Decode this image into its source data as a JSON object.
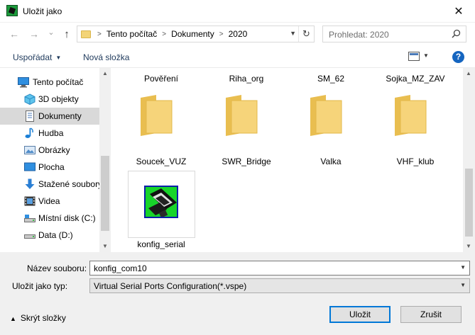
{
  "window": {
    "title": "Uložit jako",
    "close_glyph": "✕"
  },
  "nav": {
    "back_glyph": "←",
    "forward_glyph": "→",
    "recent_glyph": "⌄",
    "up_glyph": "↑",
    "breadcrumbs": [
      "Tento počítač",
      "Dokumenty",
      "2020"
    ],
    "search_placeholder": "Prohledat: 2020"
  },
  "toolbar": {
    "organize": "Uspořádat",
    "new_folder": "Nová složka",
    "help": "?"
  },
  "sidebar": {
    "items": [
      {
        "label": "Tento počítač",
        "icon": "computer-icon"
      },
      {
        "label": "3D objekty",
        "icon": "3d-objects-icon"
      },
      {
        "label": "Dokumenty",
        "icon": "documents-icon",
        "selected": true
      },
      {
        "label": "Hudba",
        "icon": "music-icon"
      },
      {
        "label": "Obrázky",
        "icon": "pictures-icon"
      },
      {
        "label": "Plocha",
        "icon": "desktop-icon"
      },
      {
        "label": "Stažené soubory",
        "icon": "downloads-icon"
      },
      {
        "label": "Videa",
        "icon": "videos-icon"
      },
      {
        "label": "Místní disk (C:)",
        "icon": "local-disk-icon"
      },
      {
        "label": "Data (D:)",
        "icon": "data-disk-icon"
      }
    ]
  },
  "files": {
    "top_row": [
      "Pověření",
      "Riha_org",
      "SM_62",
      "Sojka_MZ_ZAV"
    ],
    "folders": [
      "Soucek_VUZ",
      "SWR_Bridge",
      "Valka",
      "VHF_klub"
    ],
    "file": {
      "name": "konfig_serial",
      "icon": "vspe-config-icon"
    }
  },
  "form": {
    "filename_label": "Název souboru:",
    "filename_value": "konfig_com10",
    "filetype_label": "Uložit jako typ:",
    "filetype_value": "Virtual Serial Ports Configuration(*.vspe)"
  },
  "footer": {
    "hide_folders": "Skrýt složky",
    "save": "Uložit",
    "cancel": "Zrušit"
  },
  "colors": {
    "accent": "#0078d7",
    "folder": "#f6d47a",
    "selection": "#d9d9d9"
  }
}
